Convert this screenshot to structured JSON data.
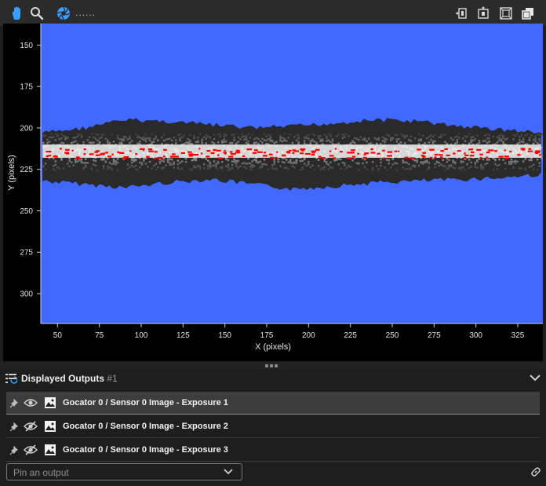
{
  "toolbar": {
    "left_tools": [
      "hand-pan-icon",
      "zoom-icon",
      "aperture-icon"
    ],
    "status_text": "......",
    "right_tools": [
      "fit-width-icon",
      "fit-height-icon",
      "fit-screen-icon",
      "overlay-icon"
    ]
  },
  "chart_data": {
    "type": "heatmap",
    "xlabel": "X (pixels)",
    "ylabel": "Y (pixels)",
    "xlim": [
      40,
      340
    ],
    "ylim": [
      318,
      137
    ],
    "x_ticks": [
      50,
      75,
      100,
      125,
      150,
      175,
      200,
      225,
      250,
      275,
      300,
      325
    ],
    "y_ticks": [
      150,
      175,
      200,
      225,
      250,
      275,
      300
    ],
    "grid": false,
    "band": {
      "description_values": {
        "x_range": [
          41,
          339
        ],
        "outer_top_y": [
          203,
          200,
          195,
          196,
          198,
          200,
          199,
          197,
          195,
          196,
          199,
          201,
          203
        ],
        "outer_bottom_y": [
          232,
          234,
          236,
          233,
          231,
          234,
          237,
          235,
          233,
          232,
          231,
          230,
          228
        ],
        "sample_x": [
          41,
          66,
          91,
          116,
          141,
          166,
          191,
          216,
          241,
          266,
          291,
          316,
          339
        ],
        "bright_core_center_y": 214,
        "bright_core_halfwidth": 4,
        "red_saturated_center_y": 215
      }
    },
    "colors": {
      "background": "#4169ff",
      "band_dark": "#2a2a2a",
      "band_mid": "#8a8a8a",
      "band_bright": "#f5f5f5",
      "saturated": "#ff0000"
    }
  },
  "panel": {
    "title": "Displayed Outputs",
    "count": "#1",
    "collapse_icon": "chevron-down-icon",
    "rows": [
      {
        "label": "Gocator 0 / Sensor 0 Image - Exposure 1",
        "visible": true
      },
      {
        "label": "Gocator 0 / Sensor 0 Image - Exposure 2",
        "visible": false
      },
      {
        "label": "Gocator 0 / Sensor 0 Image - Exposure 3",
        "visible": false
      }
    ],
    "pin_placeholder": "Pin an output",
    "link_icon": "link-icon"
  }
}
